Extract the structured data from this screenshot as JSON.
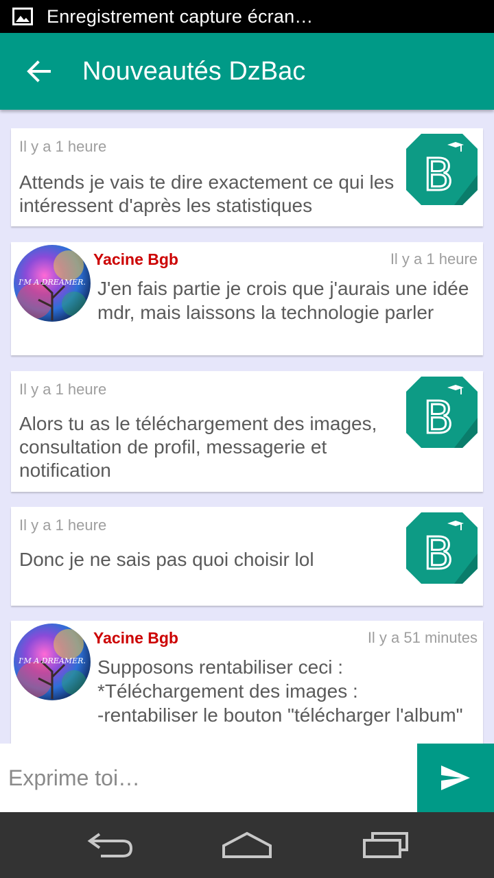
{
  "status_bar": {
    "notification_text": "Enregistrement capture écran…",
    "icon": "image-icon"
  },
  "app_bar": {
    "title": "Nouveautés DzBac",
    "back_icon": "arrow-left-icon"
  },
  "messages": [
    {
      "kind": "system",
      "time": "Il y a 1 heure",
      "text": "Attends je vais te dire exactement ce qui les intéressent d'après les statistiques"
    },
    {
      "kind": "user",
      "author": "Yacine Bgb",
      "time": "Il y a 1 heure",
      "text": "J'en fais partie je crois que j'aurais une idée mdr, mais laissons la technologie parler",
      "avatar_text": "I'M A DREAMER."
    },
    {
      "kind": "system",
      "time": "Il y a 1 heure",
      "text": "Alors tu as le téléchargement des images, consultation de profil, messagerie et notification"
    },
    {
      "kind": "system",
      "time": "Il y a 1 heure",
      "text": "Donc je ne sais pas quoi choisir lol"
    },
    {
      "kind": "user",
      "author": "Yacine Bgb",
      "time": "Il y a 51 minutes",
      "text": "Supposons rentabiliser ceci :\n*Téléchargement des images :\n-rentabiliser le bouton \"télécharger l'album\"",
      "avatar_text": "I'M A DREAMER."
    }
  ],
  "composer": {
    "placeholder": "Exprime toi…",
    "send_icon": "send-icon"
  },
  "nav_bar": {
    "back": "back-icon",
    "home": "home-icon",
    "recents": "recents-icon"
  },
  "colors": {
    "primary": "#009a87",
    "author": "#cc0000",
    "background": "#e6e6fa"
  }
}
